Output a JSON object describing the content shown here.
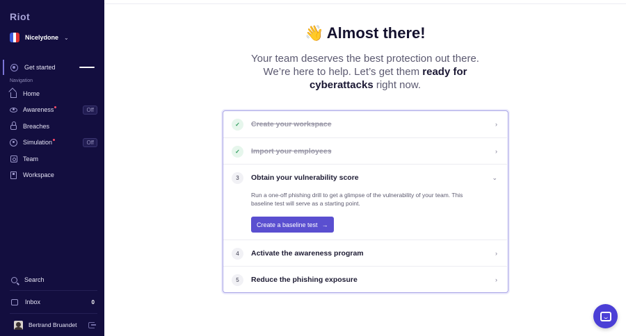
{
  "sidebar": {
    "logo": "Riot",
    "workspace": {
      "name": "Nicelydone",
      "flag_colors": [
        "#3b5bdb",
        "#ffffff",
        "#e03131"
      ]
    },
    "get_started": {
      "label": "Get started"
    },
    "nav_heading": "Navigation",
    "nav_items": [
      {
        "label": "Home",
        "icon": "home-icon"
      },
      {
        "label": "Awareness",
        "icon": "eye-icon",
        "badge": "Off",
        "dot": true
      },
      {
        "label": "Breaches",
        "icon": "lock-icon"
      },
      {
        "label": "Simulation",
        "icon": "target-icon",
        "badge": "Off",
        "dot": true
      },
      {
        "label": "Team",
        "icon": "team-icon"
      },
      {
        "label": "Workspace",
        "icon": "building-icon"
      }
    ],
    "search_label": "Search",
    "inbox_label": "Inbox",
    "inbox_count": "0",
    "user_name": "Bertrand Bruandet"
  },
  "main": {
    "title_emoji": "👋",
    "title": "Almost there!",
    "subtitle_line1": "Your team deserves the best protection out there.",
    "subtitle_line2_a": "We’re here to help. Let’s get them ",
    "subtitle_line2_b": "ready for",
    "subtitle_line3_a": "cyberattacks",
    "subtitle_line3_b": " right now.",
    "steps": [
      {
        "badge": "✓",
        "title": "Create your workspace",
        "done": true
      },
      {
        "badge": "✓",
        "title": "Import your employees",
        "done": true
      },
      {
        "badge": "3",
        "title": "Obtain your vulnerability score",
        "done": false,
        "expanded": true,
        "description": "Run a one-off phishing drill to get a glimpse of the vulnerability of your team. This baseline test will serve as a starting point.",
        "cta": "Create a baseline test",
        "cta_arrow": "→"
      },
      {
        "badge": "4",
        "title": "Activate the awareness program",
        "done": false
      },
      {
        "badge": "5",
        "title": "Reduce the phishing exposure",
        "done": false
      }
    ]
  },
  "colors": {
    "sidebar_bg": "#130e3f",
    "accent": "#5a4fd0",
    "chat_button": "#4b3fd6",
    "card_border": "#a8a4e6"
  }
}
